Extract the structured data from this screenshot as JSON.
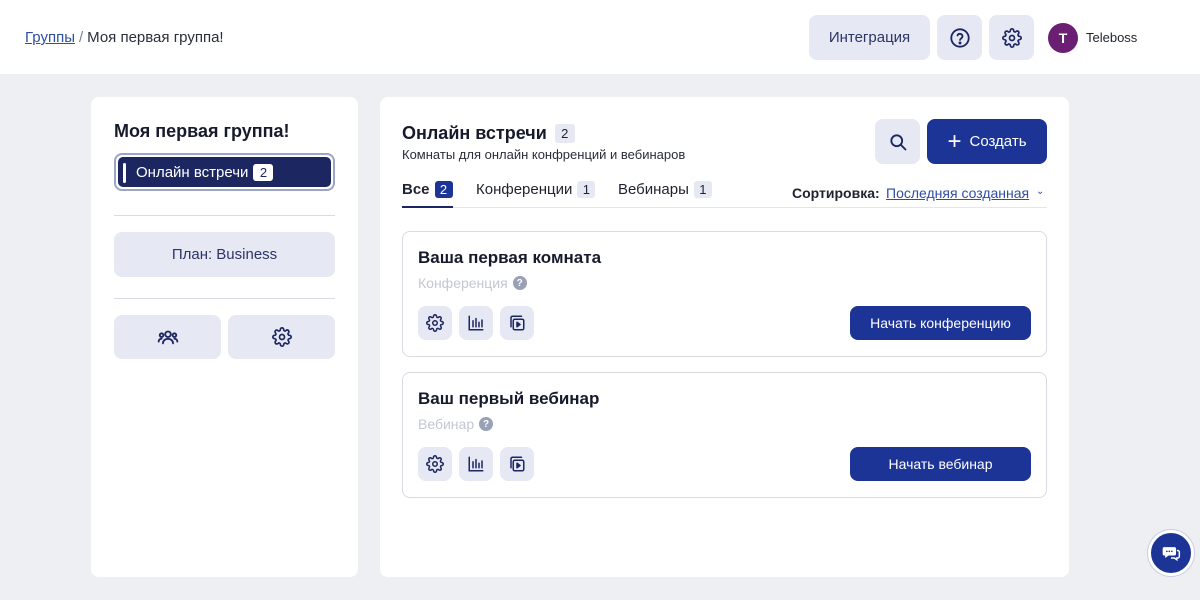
{
  "breadcrumb": {
    "root": "Группы",
    "separator": "/",
    "current": "Моя первая группа!"
  },
  "header": {
    "integration_label": "Интеграция",
    "help_icon": "question-circle-icon",
    "settings_icon": "gear-icon",
    "avatar_initial": "T",
    "username": "Teleboss",
    "avatar_color": "#6b1f73"
  },
  "sidebar": {
    "group_title": "Моя первая группа!",
    "nav": [
      {
        "label": "Онлайн встречи",
        "count": "2",
        "active": true
      }
    ],
    "plan_label": "План: Business",
    "members_icon": "users-icon",
    "group_settings_icon": "gear-icon"
  },
  "main": {
    "title": "Онлайн встречи",
    "count": "2",
    "subtitle": "Комнаты для онлайн конфренций и вебинаров",
    "search_icon": "search-icon",
    "create_label": "Создать",
    "create_icon": "plus-icon",
    "tabs": [
      {
        "label": "Все",
        "count": "2",
        "active": true
      },
      {
        "label": "Конференции",
        "count": "1",
        "active": false
      },
      {
        "label": "Вебинары",
        "count": "1",
        "active": false
      }
    ],
    "sort": {
      "label": "Сортировка:",
      "value": "Последняя созданная",
      "chevron": "⌄"
    },
    "rooms": [
      {
        "title": "Ваша первая комната",
        "type": "Конференция",
        "action": "Начать конференцию",
        "icons": [
          "gear-icon",
          "stats-icon",
          "recordings-icon"
        ]
      },
      {
        "title": "Ваш первый вебинар",
        "type": "Вебинар",
        "action": "Начать вебинар",
        "icons": [
          "gear-icon",
          "stats-icon",
          "recordings-icon"
        ]
      }
    ]
  },
  "chat_widget": {
    "icon": "chat-icon"
  },
  "colors": {
    "accent": "#1c3496",
    "nav_active_bg": "#1c2661",
    "soft_button_bg": "#e6e8f3",
    "link": "#2f4ea3",
    "page_bg": "#eeeff2"
  }
}
